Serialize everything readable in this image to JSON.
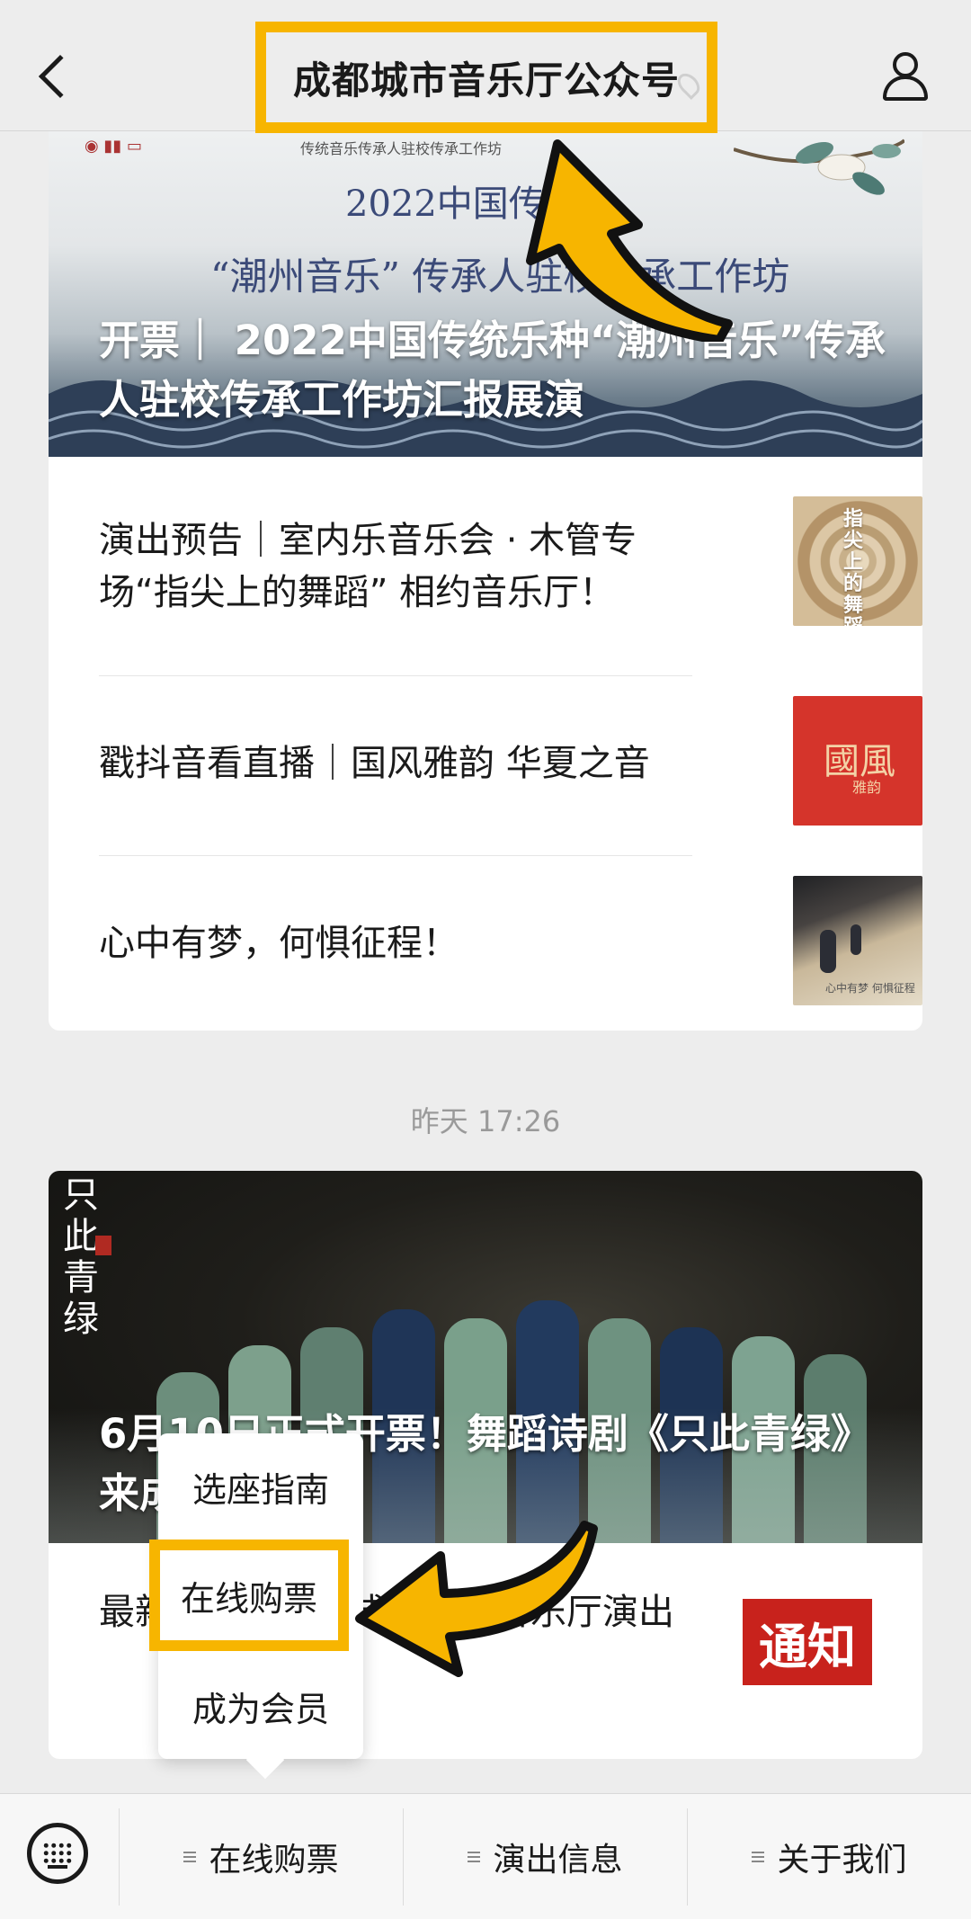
{
  "header": {
    "title": "成都城市音乐厅公众号",
    "highlight_color": "#f7b500"
  },
  "article_group_1": {
    "hero": {
      "poster_line1": "2022中国传统",
      "poster_line2": "“潮州音乐” 传承人驻校传承工作坊",
      "poster_logo_caption": "传统音乐传承人驻校传承工作坊",
      "title": "开票｜ 2022中国传统乐种“潮州音乐”传承人驻校传承工作坊汇报展演"
    },
    "items": [
      {
        "title": "演出预告｜室内乐音乐会 · 木管专场“指尖上的舞蹈” 相约音乐厅！",
        "thumb_text": "指尖上的舞蹈"
      },
      {
        "title": "戳抖音看直播｜国风雅韵 华夏之音",
        "thumb_text": "國風",
        "thumb_sub": "雅韵"
      },
      {
        "title": "心中有梦，何惧征程！",
        "thumb_caption": "心中有梦 何惧征程"
      }
    ]
  },
  "timestamp": "昨天 17:26",
  "article_group_2": {
    "hero": {
      "calligraphy": "只此青绿",
      "title": "6月10日正式开票！舞蹈诗剧《只此青绿》来成都"
    },
    "item": {
      "title": "最新通知｜近期成都城市音乐厅演出",
      "thumb_text": "通知"
    }
  },
  "popup_menu": {
    "items": [
      "选座指南",
      "在线购票",
      "成为会员"
    ],
    "selected_index": 1
  },
  "bottom_bar": {
    "tabs": [
      "在线购票",
      "演出信息",
      "关于我们"
    ]
  }
}
